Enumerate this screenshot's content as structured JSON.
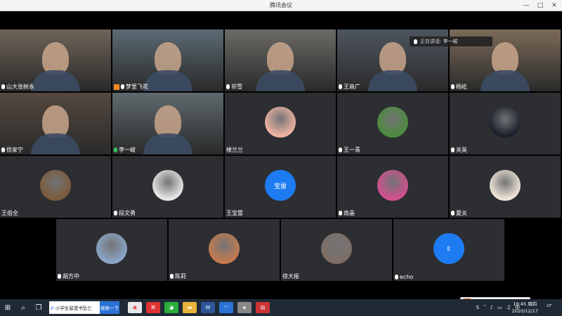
{
  "window": {
    "title": "腾讯会议",
    "controls": [
      "—",
      "□",
      "✕"
    ]
  },
  "speaking_indicator": "正在讲话: 李一峻",
  "participants": [
    {
      "name": "山大张树永",
      "mic": "on",
      "type": "video",
      "bg": "#6f6358"
    },
    {
      "name": "梦里飞花",
      "mic": "on",
      "type": "video",
      "bg": "#5b6a73",
      "extra_badge": "orange"
    },
    {
      "name": "祁雪",
      "mic": "on",
      "type": "video",
      "bg": "#6c6a66"
    },
    {
      "name": "王商广",
      "mic": "on",
      "type": "video",
      "bg": "#4e5560"
    },
    {
      "name": "杨屹",
      "mic": "on",
      "type": "video",
      "bg": "#7b6a59"
    },
    {
      "name": "徐家宁",
      "mic": "on",
      "type": "video",
      "bg": "#55493f"
    },
    {
      "name": "李一峻",
      "mic": "green",
      "type": "video",
      "bg": "#5f6a6e"
    },
    {
      "name": "楼兰兰",
      "mic": "none",
      "type": "avatar",
      "avatar_color": "#f1b3a1"
    },
    {
      "name": "王一青",
      "mic": "on",
      "type": "avatar",
      "avatar_color": "#4b8a3c"
    },
    {
      "name": "关英",
      "mic": "on",
      "type": "avatar",
      "avatar_color": "#1b1f2c"
    },
    {
      "name": "王伯全",
      "mic": "none",
      "type": "avatar",
      "avatar_color": "#7c5a3b"
    },
    {
      "name": "段文勇",
      "mic": "on",
      "type": "avatar",
      "avatar_color": "#e8e8e8"
    },
    {
      "name": "王宝雷",
      "mic": "none",
      "type": "avatar-text",
      "avatar_text": "宝雷"
    },
    {
      "name": "南晶",
      "mic": "on",
      "type": "avatar",
      "avatar_color": "#d24f8e"
    },
    {
      "name": "夏炎",
      "mic": "on",
      "type": "avatar",
      "avatar_color": "#f0e6d8"
    },
    {
      "name": "胡方中",
      "mic": "on",
      "type": "avatar",
      "avatar_color": "#8aa6c9"
    },
    {
      "name": "陈莉",
      "mic": "on",
      "type": "avatar",
      "avatar_color": "#c77a4d"
    },
    {
      "name": "徐大振",
      "mic": "none",
      "type": "avatar",
      "avatar_color": "#7d6e65"
    },
    {
      "name": "echo",
      "mic": "on",
      "type": "avatar-text",
      "avatar_text": "E"
    }
  ],
  "ime": {
    "logo": "S",
    "lang": "中"
  },
  "taskbar": {
    "search_text": "小学生留遗书坠亡",
    "search_button": "搜索一下",
    "tray_lang": "中",
    "time": "16:45 周四",
    "date": "2020/12/17"
  }
}
